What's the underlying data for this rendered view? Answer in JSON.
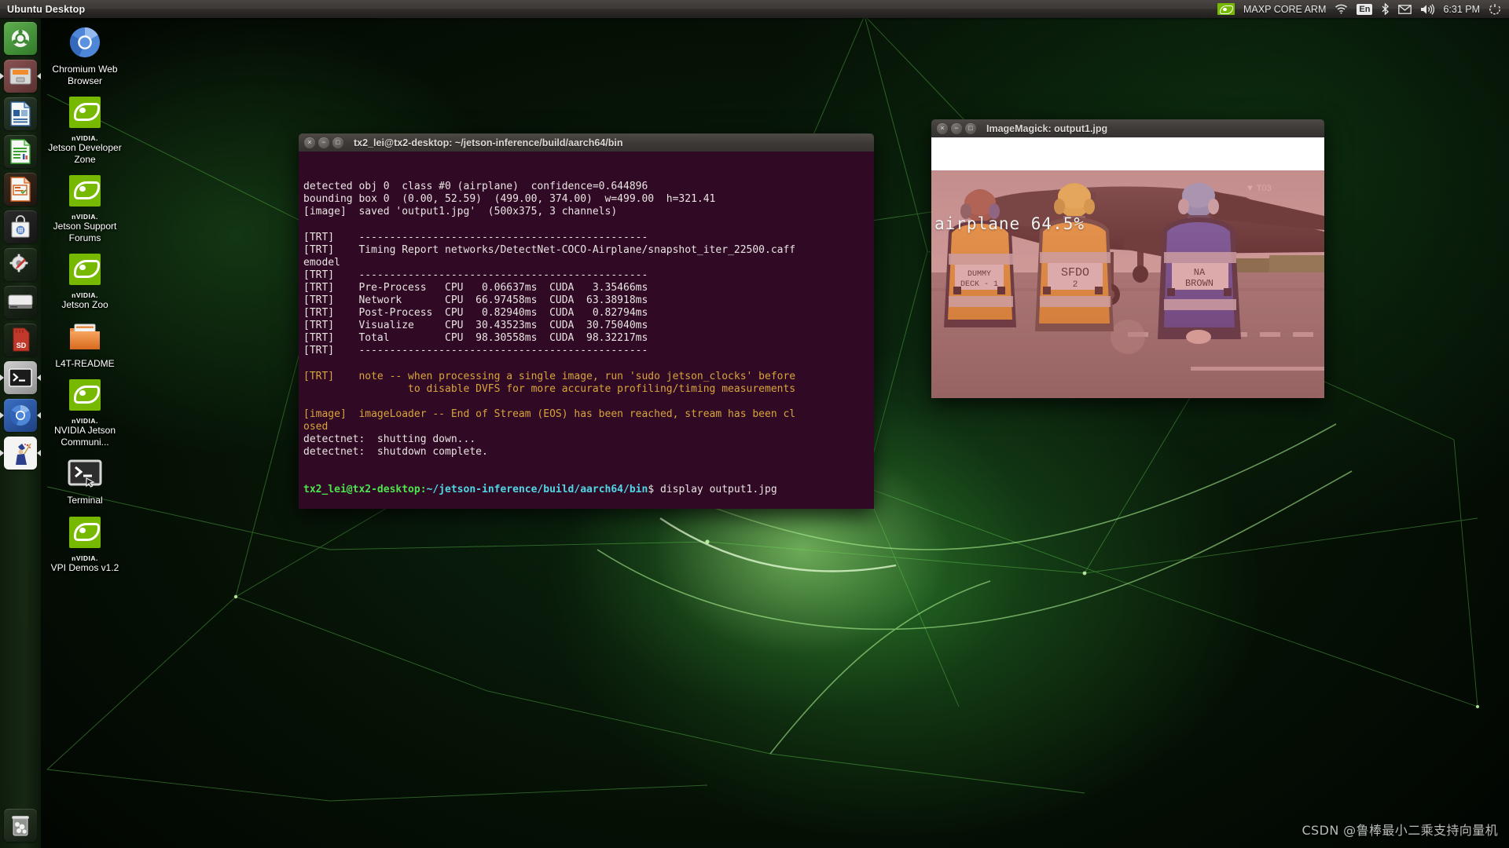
{
  "panel": {
    "title": "Ubuntu Desktop",
    "tray": {
      "nvidia_icon": "nvidia-logo-icon",
      "profile_label": "MAXP CORE ARM",
      "wifi_icon": "wifi-icon",
      "keyboard_layout": "En",
      "bluetooth_icon": "bluetooth-icon",
      "mail_icon": "mail-icon",
      "volume_icon": "volume-icon",
      "clock": "6:31 PM",
      "session_icon": "gear-power-icon"
    }
  },
  "launcher": {
    "items": [
      {
        "name": "ubuntu-dash",
        "icon": "ubuntu-logo-icon",
        "running": false
      },
      {
        "name": "files",
        "icon": "file-cabinet-icon",
        "running": true
      },
      {
        "name": "libreoffice-writer",
        "icon": "document-icon",
        "running": false
      },
      {
        "name": "libreoffice-calc",
        "icon": "spreadsheet-icon",
        "running": false
      },
      {
        "name": "libreoffice-impress",
        "icon": "presentation-icon",
        "running": false
      },
      {
        "name": "software-center",
        "icon": "shopping-bag-icon",
        "running": false
      },
      {
        "name": "system-settings",
        "icon": "gear-wrench-icon",
        "running": false
      },
      {
        "name": "disk-drive",
        "icon": "hard-drive-icon",
        "running": false
      },
      {
        "name": "sd-card",
        "icon": "sd-card-icon",
        "running": false
      },
      {
        "name": "terminal",
        "icon": "terminal-icon",
        "running": true
      },
      {
        "name": "chromium",
        "icon": "chromium-icon",
        "running": true
      },
      {
        "name": "imagemagick",
        "icon": "wizard-icon",
        "running": true
      }
    ],
    "trash": {
      "name": "trash",
      "icon": "trash-icon"
    }
  },
  "desktop_icons": [
    {
      "icon": "chromium-icon",
      "label": "Chromium Web Browser",
      "brand": ""
    },
    {
      "icon": "nvidia-logo-icon",
      "brand": "nVIDIA.",
      "label": "Jetson Developer Zone"
    },
    {
      "icon": "nvidia-logo-icon",
      "brand": "nVIDIA.",
      "label": "Jetson Support Forums"
    },
    {
      "icon": "nvidia-logo-icon",
      "brand": "nVIDIA.",
      "label": "Jetson Zoo"
    },
    {
      "icon": "folder-icon",
      "brand": "",
      "label": "L4T-README"
    },
    {
      "icon": "nvidia-logo-icon",
      "brand": "nVIDIA.",
      "label": "NVIDIA Jetson Communi..."
    },
    {
      "icon": "terminal-icon",
      "brand": "",
      "label": "Terminal"
    },
    {
      "icon": "nvidia-logo-icon",
      "brand": "nVIDIA.",
      "label": "VPI Demos v1.2"
    }
  ],
  "terminal": {
    "title": "tx2_lei@tx2-desktop: ~/jetson-inference/build/aarch64/bin",
    "buttons": {
      "close": "×",
      "minimize": "−",
      "maximize": "□"
    },
    "lines": [
      {
        "text": "detected obj 0  class #0 (airplane)  confidence=0.644896"
      },
      {
        "text": "bounding box 0  (0.00, 52.59)  (499.00, 374.00)  w=499.00  h=321.41"
      },
      {
        "text": "[image]  saved 'output1.jpg'  (500x375, 3 channels)"
      },
      {
        "text": ""
      },
      {
        "text": "[TRT]    -----------------------------------------------"
      },
      {
        "text": "[TRT]    Timing Report networks/DetectNet-COCO-Airplane/snapshot_iter_22500.caff"
      },
      {
        "text": "emodel"
      },
      {
        "text": "[TRT]    -----------------------------------------------"
      },
      {
        "text": "[TRT]    Pre-Process   CPU   0.06637ms  CUDA   3.35466ms"
      },
      {
        "text": "[TRT]    Network       CPU  66.97458ms  CUDA  63.38918ms"
      },
      {
        "text": "[TRT]    Post-Process  CPU   0.82940ms  CUDA   0.82794ms"
      },
      {
        "text": "[TRT]    Visualize     CPU  30.43523ms  CUDA  30.75040ms"
      },
      {
        "text": "[TRT]    Total         CPU  98.30558ms  CUDA  98.32217ms"
      },
      {
        "text": "[TRT]    -----------------------------------------------"
      },
      {
        "text": ""
      },
      {
        "text": "[TRT]    note -- when processing a single image, run 'sudo jetson_clocks' before",
        "style": "comment"
      },
      {
        "text": "                 to disable DVFS for more accurate profiling/timing measurements",
        "style": "comment"
      },
      {
        "text": ""
      },
      {
        "text": "[image]  imageLoader -- End of Stream (EOS) has been reached, stream has been cl",
        "style": "comment"
      },
      {
        "text": "osed",
        "style": "comment"
      },
      {
        "text": "detectnet:  shutting down..."
      },
      {
        "text": "detectnet:  shutdown complete."
      }
    ],
    "prompt": {
      "user_host": "tx2_lei@tx2-desktop",
      "separator": ":",
      "path": "~/jetson-inference/build/aarch64/bin",
      "dollar": "$ ",
      "command": "display output1.jpg"
    }
  },
  "imagemagick": {
    "title": "ImageMagick: output1.jpg",
    "buttons": {
      "close": "×",
      "minimize": "−",
      "maximize": "□"
    },
    "detection_label": "airplane 64.5%",
    "scene": {
      "vest_labels": [
        "DUMMY DECK - 1",
        "SFDO 2",
        "NA BROWN"
      ],
      "aircraft_marking": "T03"
    }
  },
  "watermark": "CSDN @鲁棒最小二乘支持向量机",
  "colors": {
    "nvidia_green": "#76b900",
    "terminal_bg": "#300a24",
    "panel_bg": "#3c3835",
    "prompt_user": "#4ee44e",
    "prompt_path": "#51d6e6",
    "terminal_comment": "#d9a43b",
    "detection_overlay": "#d25a5f"
  }
}
